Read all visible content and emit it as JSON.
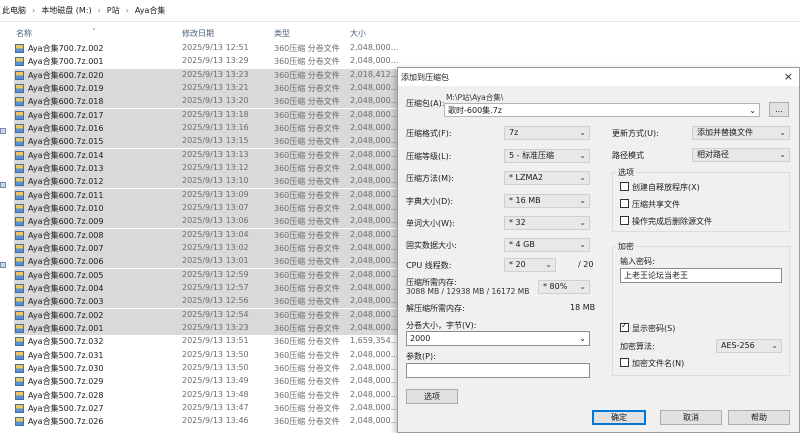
{
  "breadcrumb": [
    "此电脑",
    "本地磁盘 (M:)",
    "P站",
    "Aya合集"
  ],
  "columns": {
    "name": "名称",
    "date": "修改日期",
    "type": "类型",
    "size": "大小"
  },
  "files": [
    {
      "name": "Aya合集700.7z.002",
      "date": "2025/9/13 12:51",
      "type": "360压缩 分卷文件",
      "size": "2,048,000...",
      "selected": false
    },
    {
      "name": "Aya合集700.7z.001",
      "date": "2025/9/13 13:29",
      "type": "360压缩 分卷文件",
      "size": "2,048,000...",
      "selected": false
    },
    {
      "name": "Aya合集600.7z.020",
      "date": "2025/9/13 13:23",
      "type": "360压缩 分卷文件",
      "size": "2,018,412...",
      "selected": true
    },
    {
      "name": "Aya合集600.7z.019",
      "date": "2025/9/13 13:21",
      "type": "360压缩 分卷文件",
      "size": "2,048,000...",
      "selected": true
    },
    {
      "name": "Aya合集600.7z.018",
      "date": "2025/9/13 13:20",
      "type": "360压缩 分卷文件",
      "size": "2,048,000...",
      "selected": true
    },
    {
      "name": "Aya合集600.7z.017",
      "date": "2025/9/13 13:18",
      "type": "360压缩 分卷文件",
      "size": "2,048,000...",
      "selected": true
    },
    {
      "name": "Aya合集600.7z.016",
      "date": "2025/9/13 13:16",
      "type": "360压缩 分卷文件",
      "size": "2,048,000...",
      "selected": true
    },
    {
      "name": "Aya合集600.7z.015",
      "date": "2025/9/13 13:15",
      "type": "360压缩 分卷文件",
      "size": "2,048,000...",
      "selected": true
    },
    {
      "name": "Aya合集600.7z.014",
      "date": "2025/9/13 13:13",
      "type": "360压缩 分卷文件",
      "size": "2,048,000...",
      "selected": true
    },
    {
      "name": "Aya合集600.7z.013",
      "date": "2025/9/13 13:12",
      "type": "360压缩 分卷文件",
      "size": "2,048,000...",
      "selected": true
    },
    {
      "name": "Aya合集600.7z.012",
      "date": "2025/9/13 13:10",
      "type": "360压缩 分卷文件",
      "size": "2,048,000...",
      "selected": true
    },
    {
      "name": "Aya合集600.7z.011",
      "date": "2025/9/13 13:09",
      "type": "360压缩 分卷文件",
      "size": "2,048,000...",
      "selected": true
    },
    {
      "name": "Aya合集600.7z.010",
      "date": "2025/9/13 13:07",
      "type": "360压缩 分卷文件",
      "size": "2,048,000...",
      "selected": true
    },
    {
      "name": "Aya合集600.7z.009",
      "date": "2025/9/13 13:06",
      "type": "360压缩 分卷文件",
      "size": "2,048,000...",
      "selected": true
    },
    {
      "name": "Aya合集600.7z.008",
      "date": "2025/9/13 13:04",
      "type": "360压缩 分卷文件",
      "size": "2,048,000...",
      "selected": true
    },
    {
      "name": "Aya合集600.7z.007",
      "date": "2025/9/13 13:02",
      "type": "360压缩 分卷文件",
      "size": "2,048,000...",
      "selected": true
    },
    {
      "name": "Aya合集600.7z.006",
      "date": "2025/9/13 13:01",
      "type": "360压缩 分卷文件",
      "size": "2,048,000...",
      "selected": true
    },
    {
      "name": "Aya合集600.7z.005",
      "date": "2025/9/13 12:59",
      "type": "360压缩 分卷文件",
      "size": "2,048,000...",
      "selected": true
    },
    {
      "name": "Aya合集600.7z.004",
      "date": "2025/9/13 12:57",
      "type": "360压缩 分卷文件",
      "size": "2,048,000...",
      "selected": true
    },
    {
      "name": "Aya合集600.7z.003",
      "date": "2025/9/13 12:56",
      "type": "360压缩 分卷文件",
      "size": "2,048,000...",
      "selected": true
    },
    {
      "name": "Aya合集600.7z.002",
      "date": "2025/9/13 12:54",
      "type": "360压缩 分卷文件",
      "size": "2,048,000...",
      "selected": true
    },
    {
      "name": "Aya合集600.7z.001",
      "date": "2025/9/13 13:23",
      "type": "360压缩 分卷文件",
      "size": "2,048,000...",
      "selected": true
    },
    {
      "name": "Aya合集500.7z.032",
      "date": "2025/9/13 13:51",
      "type": "360压缩 分卷文件",
      "size": "1,659,354...",
      "selected": false
    },
    {
      "name": "Aya合集500.7z.031",
      "date": "2025/9/13 13:50",
      "type": "360压缩 分卷文件",
      "size": "2,048,000...",
      "selected": false
    },
    {
      "name": "Aya合集500.7z.030",
      "date": "2025/9/13 13:50",
      "type": "360压缩 分卷文件",
      "size": "2,048,000...",
      "selected": false
    },
    {
      "name": "Aya合集500.7z.029",
      "date": "2025/9/13 13:49",
      "type": "360压缩 分卷文件",
      "size": "2,048,000...",
      "selected": false
    },
    {
      "name": "Aya合集500.7z.028",
      "date": "2025/9/13 13:48",
      "type": "360压缩 分卷文件",
      "size": "2,048,000...",
      "selected": false
    },
    {
      "name": "Aya合集500.7z.027",
      "date": "2025/9/13 13:47",
      "type": "360压缩 分卷文件",
      "size": "2,048,000...",
      "selected": false
    },
    {
      "name": "Aya合集500.7z.026",
      "date": "2025/9/13 13:46",
      "type": "360压缩 分卷文件",
      "size": "2,048,000...",
      "selected": false
    }
  ],
  "dialog": {
    "title": "添加到压缩包",
    "close": "×",
    "archive_label": "压缩包(A):",
    "archive_path": "M:\\P站\\Aya合集\\",
    "archive_name": "歌时-600集.7z",
    "browse": "...",
    "format_label": "压缩格式(F):",
    "format": "7z",
    "level_label": "压缩等级(L):",
    "level": "5 - 标准压缩",
    "method_label": "压缩方法(M):",
    "method": "* LZMA2",
    "dict_label": "字典大小(D):",
    "dict": "* 16 MB",
    "word_label": "单词大小(W):",
    "word": "* 32",
    "solid_label": "固实数据大小:",
    "solid": "* 4 GB",
    "cpu_label": "CPU 线程数:",
    "cpu": "* 20",
    "cpu_total": "/ 20",
    "mem_comp_label": "压缩所需内存:",
    "mem_comp": "3088 MB / 12938 MB / 16172 MB",
    "mem_pct": "* 80%",
    "mem_decomp_label": "解压缩所需内存:",
    "mem_decomp": "18 MB",
    "split_label": "分卷大小，字节(V):",
    "split": "2000",
    "params_label": "参数(P):",
    "params": "",
    "options_button": "选项",
    "update_label": "更新方式(U):",
    "update": "添加并替换文件",
    "path_label": "路径模式",
    "path_mode": "相对路径",
    "opts_title": "选项",
    "opt_sfx": "创建自释放程序(X)",
    "opt_sfx_checked": false,
    "opt_shared": "压缩共享文件",
    "opt_shared_checked": false,
    "opt_delete": "操作完成后删除源文件",
    "opt_delete_checked": false,
    "enc_title": "加密",
    "enc_pw_label": "输入密码:",
    "enc_pw": "上老王论坛当老王",
    "show_pw": "显示密码(S)",
    "show_pw_checked": true,
    "enc_method_label": "加密算法:",
    "enc_method": "AES-256",
    "enc_names": "加密文件名(N)",
    "enc_names_checked": false,
    "ok": "确定",
    "cancel": "取消",
    "help": "帮助"
  }
}
